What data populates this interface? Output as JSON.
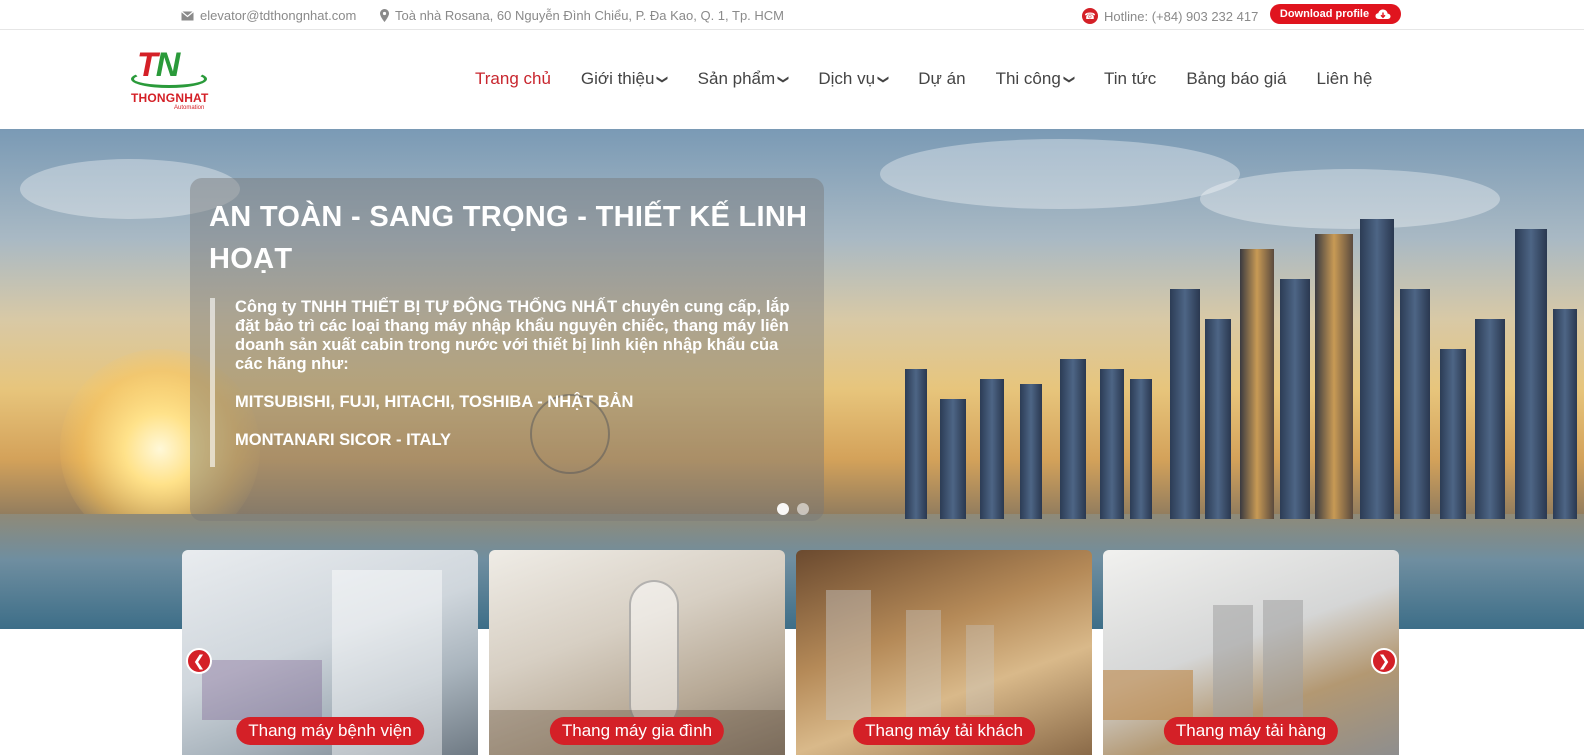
{
  "topbar": {
    "email": "elevator@tdthongnhat.com",
    "address": "Toà nhà Rosana, 60 Nguyễn Đình Chiểu, P. Đa Kao, Q. 1, Tp. HCM",
    "hotline": "Hotline: (+84) 903 232 417",
    "download_label": "Download profile"
  },
  "logo": {
    "mark_t": "T",
    "mark_n": "N",
    "name": "THONGNHAT",
    "sub": "Automation"
  },
  "nav": {
    "items": [
      {
        "label": "Trang chủ",
        "active": true
      },
      {
        "label": "Giới thiệu",
        "dropdown": true
      },
      {
        "label": "Sản phẩm",
        "dropdown": true
      },
      {
        "label": "Dịch vụ",
        "dropdown": true
      },
      {
        "label": "Dự án"
      },
      {
        "label": "Thi công",
        "dropdown": true
      },
      {
        "label": "Tin tức"
      },
      {
        "label": "Bảng báo giá"
      },
      {
        "label": "Liên hệ"
      }
    ]
  },
  "hero": {
    "title": "AN TOÀN - SANG TRỌNG - THIẾT KẾ LINH HOẠT",
    "paragraphs": [
      "Công ty TNHH THIẾT BỊ TỰ ĐỘNG THỐNG NHẤT chuyên cung cấp, lắp đặt bảo trì các loại thang máy nhập khẩu nguyên chiếc, thang máy liên doanh sản xuất cabin trong nước với thiết bị linh kiện nhập khẩu của các hãng như:",
      "MITSUBISHI, FUJI, HITACHI, TOSHIBA - NHẬT BẢN",
      "MONTANARI SICOR - ITALY"
    ],
    "slides": 2,
    "current_slide": 1
  },
  "categories": [
    {
      "label": "Thang máy bệnh viện"
    },
    {
      "label": "Thang máy gia đình"
    },
    {
      "label": "Thang máy tải khách"
    },
    {
      "label": "Thang máy tải hàng"
    }
  ],
  "icons": {
    "email": "envelope-icon",
    "address": "map-marker-icon",
    "hotline": "phone-icon",
    "download": "cloud-download-icon",
    "dropdown": "chevron-down-icon",
    "prev": "chevron-left-icon",
    "next": "chevron-right-icon"
  },
  "colors": {
    "brand_red": "#d42027",
    "brand_green": "#2a9a3a",
    "nav_text": "#444444"
  }
}
